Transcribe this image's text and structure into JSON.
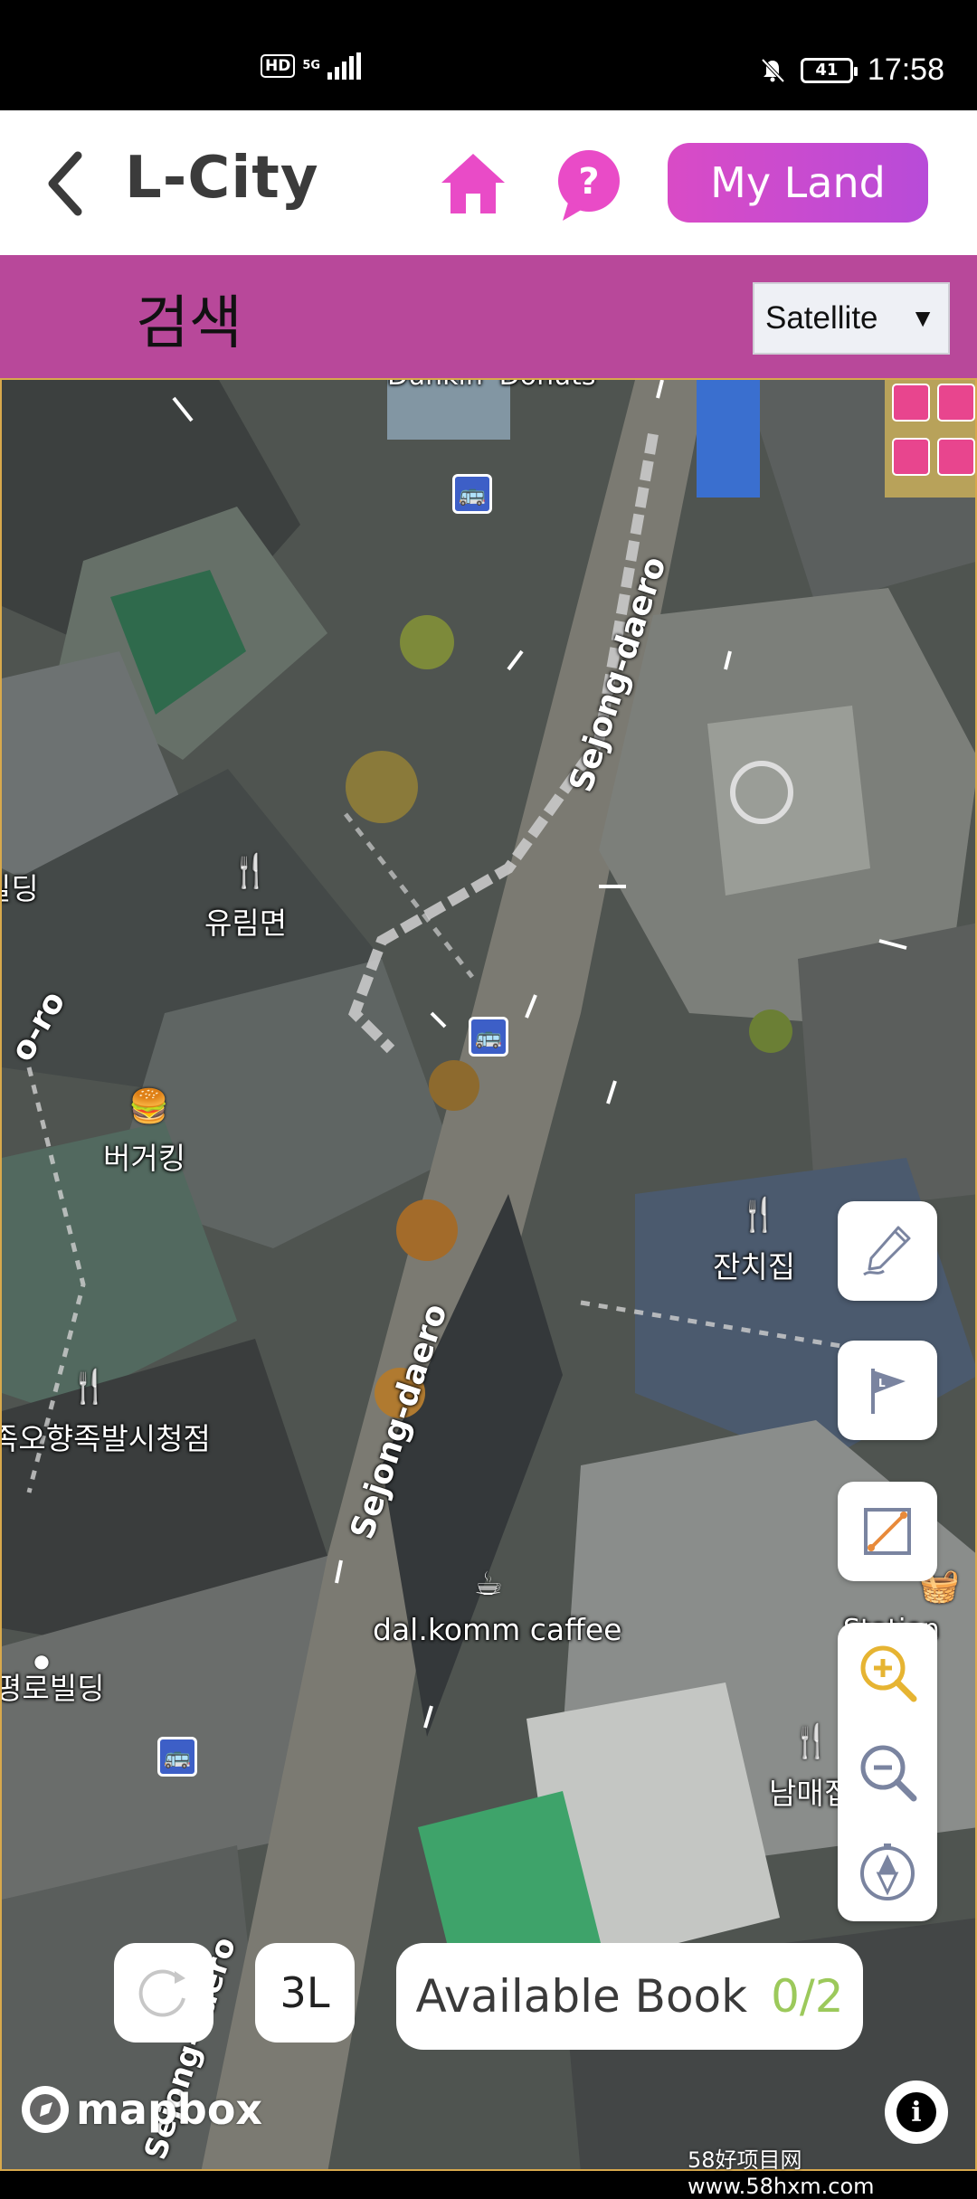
{
  "status_bar": {
    "hd": "HD",
    "network": "5G",
    "battery": "41",
    "time": "17:58"
  },
  "header": {
    "title": "L-City",
    "my_land_label": "My Land",
    "accent": "#e040c0"
  },
  "search": {
    "label": "검색",
    "map_type_selected": "Satellite"
  },
  "map": {
    "roads": [
      "Sejong-daero",
      "Sejong-daero",
      "o-ro",
      "Sejong-daero"
    ],
    "pois": [
      {
        "name": "유림면",
        "icon": "restaurant-icon"
      },
      {
        "name": "버거킹",
        "icon": "burger-icon"
      },
      {
        "name": "잔치집",
        "icon": "restaurant-icon"
      },
      {
        "name": "족오향족발시청점",
        "icon": "restaurant-icon"
      },
      {
        "name": "dal.komm caffee",
        "icon": "cafe-icon"
      },
      {
        "name": "평로빌딩",
        "icon": "dot-icon"
      },
      {
        "name": "남매집",
        "icon": "restaurant-icon"
      },
      {
        "name": "빌딩",
        "icon": "none"
      },
      {
        "name": "Dunkin' Donuts",
        "icon": "none"
      },
      {
        "name": "Station",
        "icon": "shop-icon"
      }
    ]
  },
  "tools": {
    "icons": [
      "pen-icon",
      "flag-icon",
      "measure-icon",
      "zoom-in-icon",
      "zoom-out-icon",
      "compass-icon"
    ]
  },
  "bottom": {
    "level": "3L",
    "available_label": "Available Book",
    "available_count": "0/2",
    "count_color": "#9cc95b",
    "brand": "mapbox",
    "watermark": "58好项目网www.58hxm.com"
  }
}
